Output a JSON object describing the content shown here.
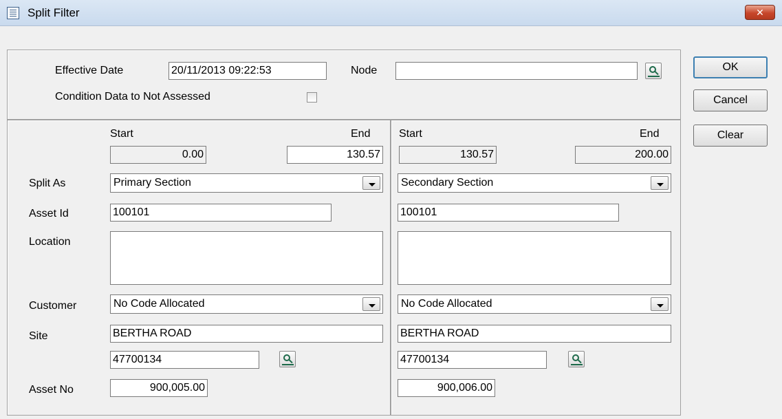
{
  "window": {
    "title": "Split Filter",
    "close_label": "✕"
  },
  "header": {
    "effective_date_label": "Effective Date",
    "effective_date_value": "20/11/2013 09:22:53",
    "node_label": "Node",
    "node_value": "",
    "condition_label": "Condition Data to Not Assessed",
    "condition_checked": false
  },
  "labels": {
    "start": "Start",
    "end": "End",
    "split_as": "Split As",
    "asset_id": "Asset Id",
    "location": "Location",
    "customer": "Customer",
    "site": "Site",
    "asset_no": "Asset No"
  },
  "left": {
    "start": "0.00",
    "end": "130.57",
    "split_as": "Primary Section",
    "asset_id": "100101",
    "location": "",
    "customer": "No Code Allocated",
    "site": "BERTHA ROAD",
    "site_code": "47700134",
    "asset_no": "900,005.00"
  },
  "right": {
    "start": "130.57",
    "end": "200.00",
    "split_as": "Secondary Section",
    "asset_id": "100101",
    "location": "",
    "customer": "No Code Allocated",
    "site": "BERTHA ROAD",
    "site_code": "47700134",
    "asset_no": "900,006.00"
  },
  "buttons": {
    "ok": "OK",
    "cancel": "Cancel",
    "clear": "Clear"
  },
  "icons": {
    "lookup": "lookup-icon",
    "dropdown": "chevron-down-icon",
    "window": "form-icon"
  }
}
